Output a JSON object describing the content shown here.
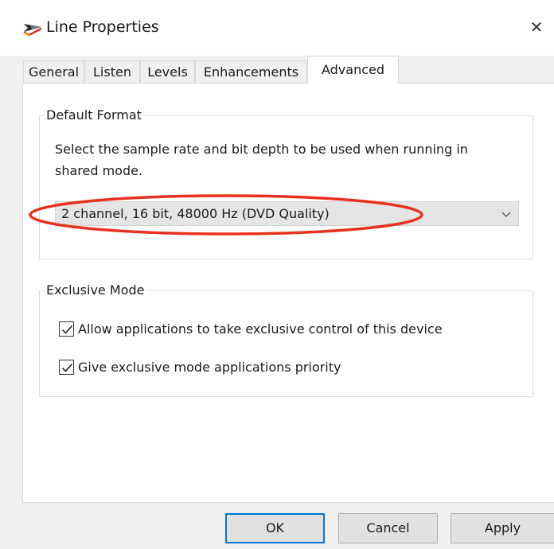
{
  "window": {
    "title": "Line Properties",
    "close_glyph": "✕"
  },
  "tabs": [
    {
      "label": "General",
      "active": false
    },
    {
      "label": "Listen",
      "active": false
    },
    {
      "label": "Levels",
      "active": false
    },
    {
      "label": "Enhancements",
      "active": false
    },
    {
      "label": "Advanced",
      "active": true
    }
  ],
  "default_format": {
    "group_label": "Default Format",
    "description_line1": "Select the sample rate and bit depth to be used when running in",
    "description_line2": "shared mode.",
    "selected_format": "2 channel, 16 bit, 48000 Hz (DVD Quality)"
  },
  "exclusive_mode": {
    "group_label": "Exclusive Mode",
    "allow_exclusive_label": "Allow applications to take exclusive control of this device",
    "allow_exclusive_checked": true,
    "priority_label": "Give exclusive mode applications priority",
    "priority_checked": true
  },
  "buttons": {
    "ok": "OK",
    "cancel": "Cancel",
    "apply": "Apply"
  },
  "colors": {
    "annotation_ellipse": "#e8311f",
    "default_button_border": "#0078d7"
  },
  "icons": {
    "title": "speaker-plug-icon",
    "close": "close-icon",
    "dropdown": "chevron-down-icon",
    "checkbox": "checkmark-icon"
  }
}
